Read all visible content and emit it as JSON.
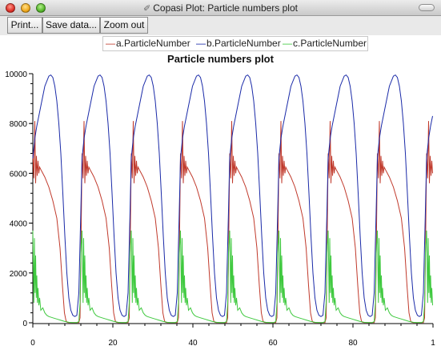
{
  "window": {
    "title": "Copasi Plot: Particle numbers plot",
    "title_icon": "feather-icon"
  },
  "toolbar": {
    "print_label": "Print...",
    "save_label": "Save data...",
    "zoom_label": "Zoom out"
  },
  "legend": [
    {
      "label": "a.ParticleNumber",
      "color": "#c0392b"
    },
    {
      "label": "b.ParticleNumber",
      "color": "#1a2aa8"
    },
    {
      "label": "c.ParticleNumber",
      "color": "#3fc93f"
    }
  ],
  "chart_data": {
    "type": "line",
    "title": "Particle numbers plot",
    "xlabel": "",
    "ylabel": "",
    "xlim": [
      0,
      100
    ],
    "ylim": [
      0,
      10000
    ],
    "x_ticks": [
      "0",
      "20",
      "40",
      "60",
      "80",
      "1"
    ],
    "y_ticks": [
      "0",
      "2000",
      "4000",
      "6000",
      "8000",
      "10000"
    ],
    "grid": false,
    "legend_position": "top",
    "period": 12.3,
    "series": [
      {
        "name": "a.ParticleNumber",
        "color": "#c0392b",
        "cycle_x": [
          0,
          0.25,
          0.5,
          0.7,
          0.9,
          1.1,
          1.3,
          1.5,
          1.7,
          2.0,
          2.5,
          3.0,
          4.0,
          5.0,
          6.0,
          6.8,
          7.4,
          7.9,
          8.3,
          8.6,
          9.0,
          10.0,
          11.0,
          11.5,
          11.8,
          12.0,
          12.3
        ],
        "cycle_y": [
          6800,
          5800,
          8100,
          5600,
          6700,
          5900,
          6500,
          6000,
          6250,
          6150,
          6000,
          5850,
          5450,
          4900,
          4200,
          3000,
          1500,
          400,
          80,
          20,
          10,
          10,
          10,
          10,
          200,
          2500,
          6800
        ]
      },
      {
        "name": "b.ParticleNumber",
        "color": "#1a2aa8",
        "cycle_x": [
          0,
          0.5,
          1.0,
          1.5,
          2.0,
          2.5,
          3.0,
          4.0,
          4.5,
          5.0,
          5.5,
          6.0,
          6.5,
          7.0,
          7.5,
          8.0,
          8.5,
          9.0,
          9.5,
          10.0,
          10.5,
          11.0,
          11.5,
          12.0,
          12.3
        ],
        "cycle_y": [
          6600,
          7400,
          7900,
          8300,
          8700,
          9100,
          9500,
          9900,
          9950,
          9850,
          9500,
          8900,
          8000,
          6800,
          5200,
          3500,
          2000,
          1000,
          500,
          300,
          250,
          300,
          1200,
          4500,
          6600
        ]
      },
      {
        "name": "c.ParticleNumber",
        "color": "#3fc93f",
        "cycle_x": [
          0,
          0.25,
          0.4,
          0.55,
          0.7,
          0.85,
          1.0,
          1.15,
          1.3,
          1.5,
          1.7,
          2.0,
          2.5,
          3.0,
          3.5,
          4.0,
          5.0,
          6.0,
          7.0,
          8.0,
          9.0,
          10.0,
          11.0,
          11.5,
          11.8,
          12.0,
          12.3
        ],
        "cycle_y": [
          3700,
          800,
          3400,
          1200,
          2700,
          1000,
          1900,
          800,
          1400,
          700,
          1000,
          500,
          600,
          400,
          300,
          250,
          200,
          150,
          100,
          50,
          20,
          10,
          10,
          50,
          800,
          2800,
          3700
        ]
      }
    ]
  }
}
